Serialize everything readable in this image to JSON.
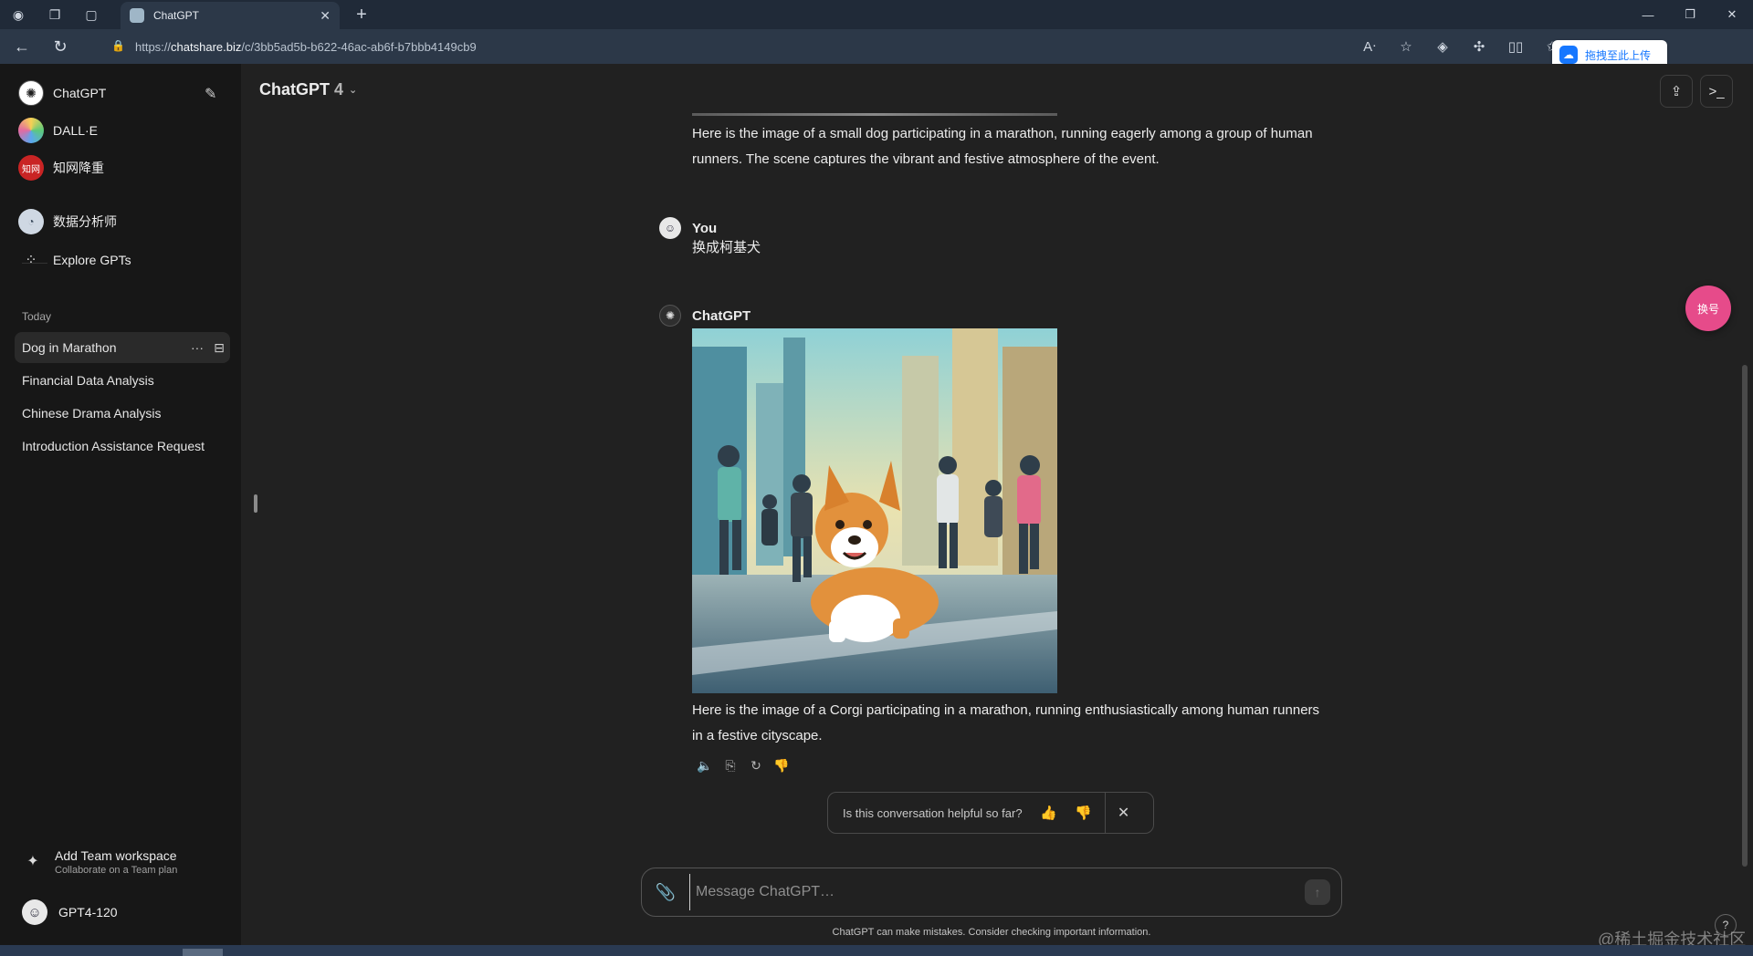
{
  "browser": {
    "tab_title": "ChatGPT",
    "url_prefix": "https://",
    "url_domain": "chatshare.biz",
    "url_path": "/c/3bb5ad5b-b622-46ac-ab6f-b7bbb4149cb9",
    "upload_label": "拖拽至此上传"
  },
  "sidebar": {
    "gpts": [
      {
        "label": "ChatGPT",
        "icon": "chatgpt-logo-icon"
      },
      {
        "label": "DALL·E",
        "icon": "dalle-icon"
      },
      {
        "label": "知网降重",
        "icon": "zhiwang-icon",
        "glyph": "知网"
      }
    ],
    "custom": [
      {
        "label": "数据分析师",
        "icon": "data-analyst-icon"
      },
      {
        "label": "Explore GPTs",
        "icon": "grid-icon"
      }
    ],
    "section_today": "Today",
    "history": [
      {
        "label": "Dog in Marathon"
      },
      {
        "label": "Financial Data Analysis"
      },
      {
        "label": "Chinese Drama Analysis"
      },
      {
        "label": "Introduction Assistance Request"
      }
    ],
    "team_title": "Add Team workspace",
    "team_subtitle": "Collaborate on a Team plan",
    "user_name": "GPT4-120"
  },
  "main": {
    "model_name": "ChatGPT",
    "model_version": "4",
    "messages": {
      "prev_reply": "Here is the image of a small dog participating in a marathon, running eagerly among a group of human runners. The scene captures the vibrant and festive atmosphere of the event.",
      "user_name": "You",
      "user_text": "换成柯基犬",
      "bot_name": "ChatGPT",
      "bot_reply": "Here is the image of a Corgi participating in a marathon, running enthusiastically among human runners in a festive cityscape."
    },
    "feedback_question": "Is this conversation helpful so far?",
    "composer_placeholder": "Message ChatGPT…",
    "disclaimer": "ChatGPT can make mistakes. Consider checking important information.",
    "swap_badge": "换号",
    "help": "?"
  },
  "watermark": "@稀土掘金技术社区",
  "colors": {
    "sidebar_bg": "#171717",
    "main_bg": "#212121",
    "badge_pink": "#e64b8a",
    "browser_chrome": "#202a38"
  }
}
